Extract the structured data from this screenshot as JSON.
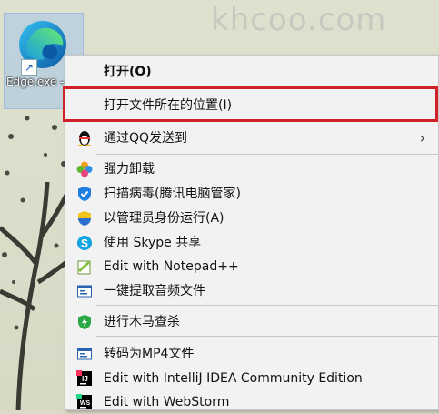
{
  "watermark": "khcoo.com",
  "desktop_icon": {
    "label": "Edge.exe - 快捷方式",
    "icon": "edge-logo-icon"
  },
  "menu": {
    "items": [
      {
        "label": "打开(O)",
        "icon": "none",
        "bold": true
      },
      {
        "label": "打开文件所在的位置(I)",
        "icon": "none",
        "highlighted": true
      },
      {
        "label": "通过QQ发送到",
        "icon": "qq-penguin-icon",
        "submenu": true
      },
      {
        "label": "强力卸载",
        "icon": "clover-icon"
      },
      {
        "label": "扫描病毒(腾讯电脑管家)",
        "icon": "shield-check-icon"
      },
      {
        "label": "以管理员身份运行(A)",
        "icon": "uac-shield-icon"
      },
      {
        "label": "使用 Skype 共享",
        "icon": "skype-icon"
      },
      {
        "label": "Edit with Notepad++",
        "icon": "notepad-plus-icon"
      },
      {
        "label": "一键提取音频文件",
        "icon": "window-icon"
      },
      {
        "label": "进行木马查杀",
        "icon": "green-shield-icon"
      },
      {
        "label": "转码为MP4文件",
        "icon": "window-icon"
      },
      {
        "label": "Edit with IntelliJ IDEA Community Edition",
        "icon": "intellij-icon"
      },
      {
        "label": "Edit with WebStorm",
        "icon": "webstorm-icon"
      }
    ],
    "submenu_arrow": "›"
  },
  "colors": {
    "highlight_border": "#d0202a",
    "menu_bg": "#f2f2f2"
  }
}
